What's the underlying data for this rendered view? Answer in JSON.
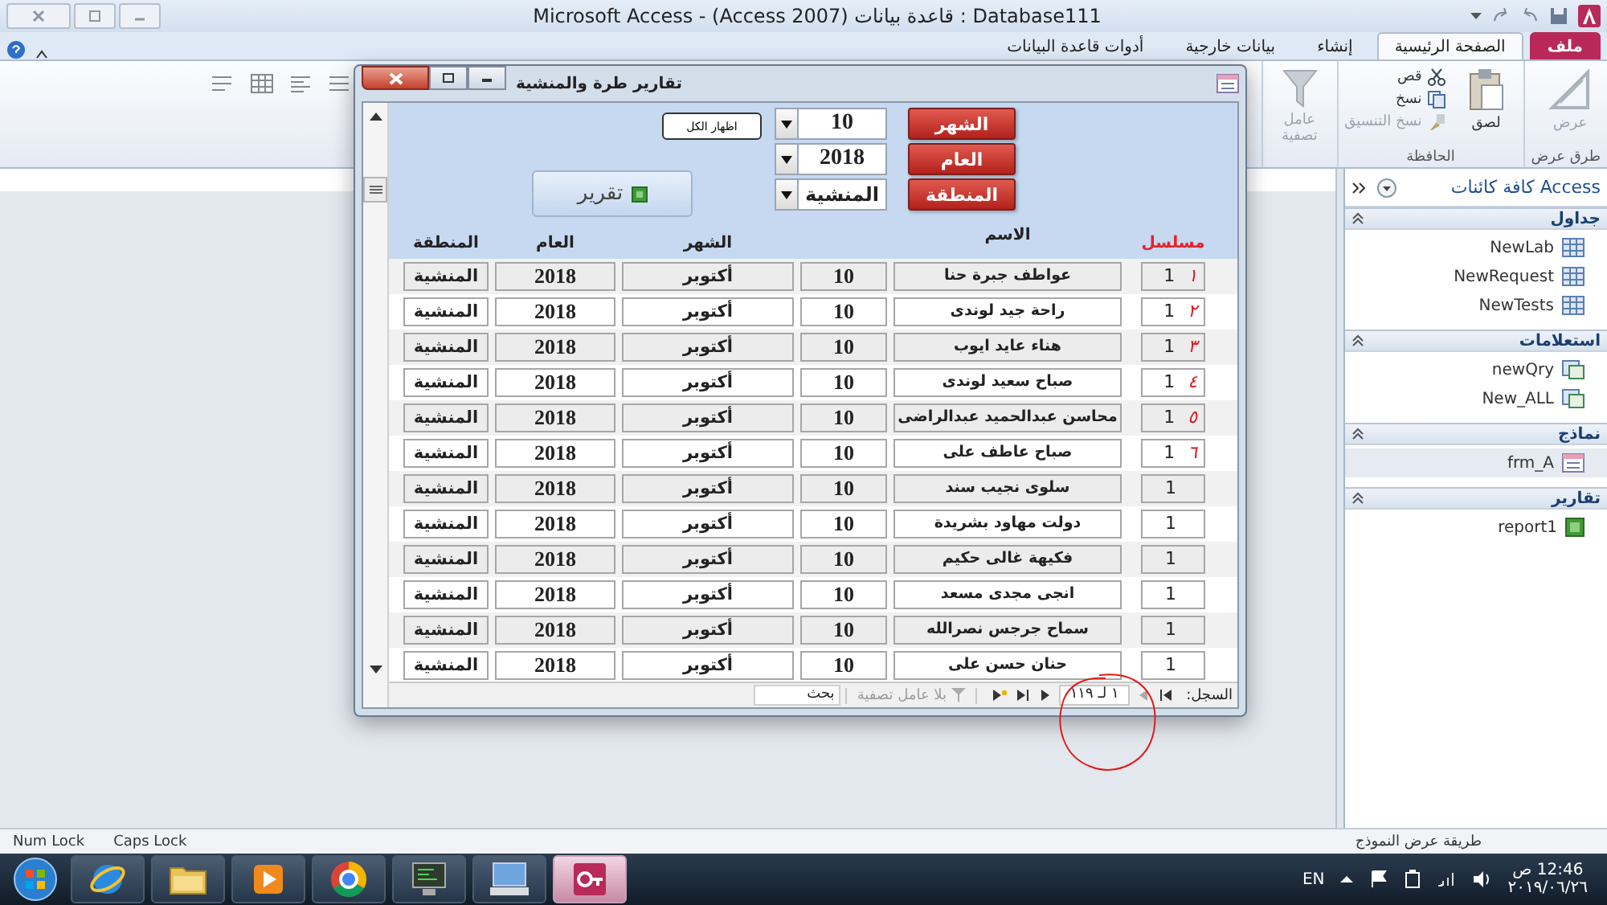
{
  "app": {
    "title": "Microsoft Access - (Access 2007) قاعدة بيانات : Database111"
  },
  "ribbon": {
    "tabs": [
      {
        "label": "ملف",
        "kind": "file",
        "selected": false
      },
      {
        "label": "الصفحة الرئيسية",
        "kind": "tab",
        "selected": true
      },
      {
        "label": "إنشاء",
        "kind": "tab",
        "selected": false
      },
      {
        "label": "بيانات خارجية",
        "kind": "tab",
        "selected": false
      },
      {
        "label": "أدوات قاعدة البيانات",
        "kind": "tab",
        "selected": false
      }
    ],
    "groups": [
      {
        "caption": "طرق عرض",
        "buttons": [
          {
            "label": "عرض",
            "kind": "view",
            "disabled": true
          }
        ]
      },
      {
        "caption": "الحافظة",
        "buttons": [
          {
            "label": "لصق",
            "kind": "paste",
            "disabled": false
          },
          {
            "label": "قص",
            "kind": "cut",
            "disabled": false
          },
          {
            "label": "نسخ",
            "kind": "copy",
            "disabled": false
          },
          {
            "label": "نسخ التنسيق",
            "kind": "format",
            "disabled": true
          }
        ]
      },
      {
        "buttons": [
          {
            "label": "عامل تصفية",
            "kind": "filter",
            "disabled": true
          }
        ]
      }
    ]
  },
  "form": {
    "title": "تقارير طرة والمنشية",
    "filters": [
      {
        "label": "الشهر",
        "value": "10"
      },
      {
        "label": "العام",
        "value": "2018"
      },
      {
        "label": "المنطقة",
        "value": "المنشية"
      }
    ],
    "show_all": "اظهار الكل",
    "report_button": "تقرير",
    "columns": [
      {
        "label": "مسلسل",
        "kind": "serial"
      },
      {
        "label": "الاسم",
        "kind": "name"
      },
      {
        "kind": "month_number"
      },
      {
        "label": "الشهر",
        "kind": "month"
      },
      {
        "label": "العام",
        "kind": "year"
      },
      {
        "label": "المنطقة",
        "kind": "region"
      }
    ],
    "rows": [
      {
        "serial": "1",
        "annotation": "١",
        "name": "عواطف جبرة حنا",
        "month_number": "10",
        "month": "أكتوبر",
        "year": "2018",
        "region": "المنشية"
      },
      {
        "serial": "1",
        "annotation": "٢",
        "name": "راحة جيد لوندى",
        "month_number": "10",
        "month": "أكتوبر",
        "year": "2018",
        "region": "المنشية"
      },
      {
        "serial": "1",
        "annotation": "٣",
        "name": "هناء عايد ايوب",
        "month_number": "10",
        "month": "أكتوبر",
        "year": "2018",
        "region": "المنشية"
      },
      {
        "serial": "1",
        "annotation": "٤",
        "name": "صباح سعيد لوندى",
        "month_number": "10",
        "month": "أكتوبر",
        "year": "2018",
        "region": "المنشية"
      },
      {
        "serial": "1",
        "annotation": "٥",
        "name": "محاسن عبدالحميد عبدالراضى",
        "month_number": "10",
        "month": "أكتوبر",
        "year": "2018",
        "region": "المنشية"
      },
      {
        "serial": "1",
        "annotation": "٦",
        "name": "صباح عاطف على",
        "month_number": "10",
        "month": "أكتوبر",
        "year": "2018",
        "region": "المنشية"
      },
      {
        "serial": "1",
        "name": "سلوى نجيب سند",
        "month_number": "10",
        "month": "أكتوبر",
        "year": "2018",
        "region": "المنشية"
      },
      {
        "serial": "1",
        "name": "دولت مهاود بشريدة",
        "month_number": "10",
        "month": "أكتوبر",
        "year": "2018",
        "region": "المنشية"
      },
      {
        "serial": "1",
        "name": "فكيهة غالى حكيم",
        "month_number": "10",
        "month": "أكتوبر",
        "year": "2018",
        "region": "المنشية"
      },
      {
        "serial": "1",
        "name": "انجى مجدى مسعد",
        "month_number": "10",
        "month": "أكتوبر",
        "year": "2018",
        "region": "المنشية"
      },
      {
        "serial": "1",
        "name": "سماح جرجس نصرالله",
        "month_number": "10",
        "month": "أكتوبر",
        "year": "2018",
        "region": "المنشية"
      },
      {
        "serial": "1",
        "name": "حنان حسن على",
        "month_number": "10",
        "month": "أكتوبر",
        "year": "2018",
        "region": "المنشية"
      }
    ],
    "navigation": {
      "label": "السجل:",
      "record": "١ لـ ١١٩",
      "filter": "بلا عامل تصفية",
      "search": "بحث"
    }
  },
  "navigation_pane": {
    "title": "كافة كائنات Access",
    "groups": [
      {
        "label": "جداول",
        "kind": "table",
        "items": [
          {
            "label": "NewLab",
            "selected": false
          },
          {
            "label": "NewRequest",
            "selected": false
          },
          {
            "label": "NewTests",
            "selected": false
          }
        ]
      },
      {
        "label": "استعلامات",
        "kind": "query",
        "items": [
          {
            "label": "newQry",
            "selected": false
          },
          {
            "label": "New_ALL",
            "selected": false
          }
        ]
      },
      {
        "label": "نماذج",
        "kind": "form",
        "items": [
          {
            "label": "frm_A",
            "selected": true
          }
        ]
      },
      {
        "label": "تقارير",
        "kind": "report",
        "items": [
          {
            "label": "report1",
            "selected": false
          }
        ]
      }
    ]
  },
  "status_bar": {
    "view": "طريقة عرض النموذج",
    "keys": [
      "Caps Lock",
      "Num Lock"
    ]
  },
  "taskbar": {
    "apps": [
      {
        "kind": "start",
        "selected": false
      },
      {
        "kind": "browser",
        "selected": false
      },
      {
        "kind": "folder",
        "selected": false
      },
      {
        "kind": "media",
        "selected": false
      },
      {
        "kind": "chrome",
        "selected": false
      },
      {
        "kind": "terminal",
        "selected": false
      },
      {
        "kind": "computer",
        "selected": false
      },
      {
        "kind": "database",
        "selected": true
      }
    ],
    "language": "EN",
    "time": "12:46 ص",
    "date": "٢٠١٩/٠٦/٢٦"
  }
}
